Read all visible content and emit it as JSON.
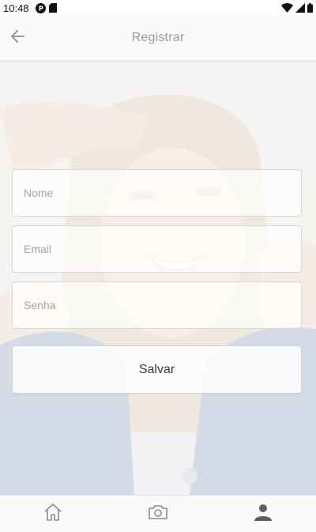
{
  "status_bar": {
    "time": "10:48",
    "left_icons": [
      "app-notification-icon",
      "sd-card-icon"
    ],
    "right_icons": [
      "wifi-icon",
      "cellular-signal-icon",
      "battery-icon"
    ]
  },
  "app_bar": {
    "title": "Registrar",
    "back_icon": "arrow-back-icon"
  },
  "form": {
    "name_placeholder": "Nome",
    "email_placeholder": "Email",
    "password_placeholder": "Senha",
    "name_value": "",
    "email_value": "",
    "password_value": "",
    "save_label": "Salvar"
  },
  "bottom_nav": {
    "items": [
      {
        "icon": "home-icon",
        "active": false
      },
      {
        "icon": "camera-icon",
        "active": false
      },
      {
        "icon": "person-icon",
        "active": true
      }
    ]
  },
  "colors": {
    "title_gray": "#9a9a9a",
    "placeholder_gray": "#a3a3a3",
    "nav_inactive": "#8d8d8d",
    "nav_active": "#5e5e5e"
  }
}
